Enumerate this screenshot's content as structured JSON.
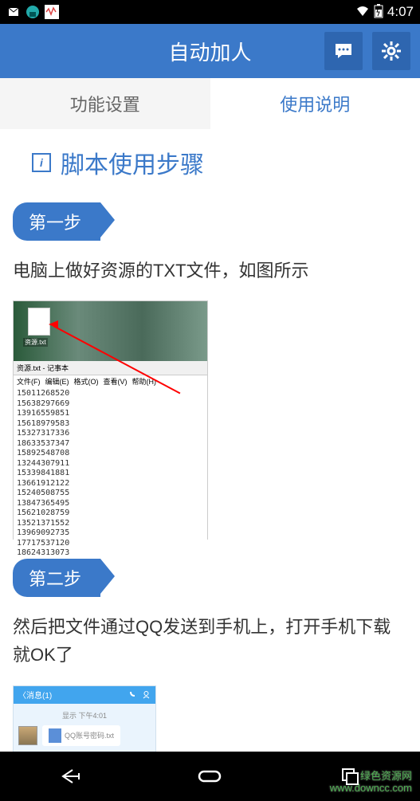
{
  "status": {
    "time": "4:07"
  },
  "header": {
    "title": "自动加人"
  },
  "tabs": {
    "settings": "功能设置",
    "instructions": "使用说明"
  },
  "section": {
    "title": "脚本使用步骤"
  },
  "steps": {
    "step1": {
      "badge": "第一步",
      "text": "电脑上做好资源的TXT文件，如图所示"
    },
    "step2": {
      "badge": "第二步",
      "text": "然后把文件通过QQ发送到手机上，打开手机下载就OK了"
    }
  },
  "notepad": {
    "file_label": "资源.txt",
    "title": "资源.txt - 记事本",
    "menu": {
      "file": "文件(F)",
      "edit": "编辑(E)",
      "format": "格式(O)",
      "view": "查看(V)",
      "help": "帮助(H)"
    },
    "numbers": [
      "15011268520",
      "15638297669",
      "13916559851",
      "15618979583",
      "15327317336",
      "18633537347",
      "15892548708",
      "13244307911",
      "15339841881",
      "13661912122",
      "15240508755",
      "13847365495",
      "15621028759",
      "13521371552",
      "13969092735",
      "17717537120",
      "18624313073"
    ]
  },
  "qq": {
    "back": "〈消息(1)",
    "time_label": "显示 下午4:01",
    "file_name": "QQ账号密码.txt"
  },
  "watermark": {
    "line1": "绿色资源网",
    "line2": "www.downcc.com"
  }
}
